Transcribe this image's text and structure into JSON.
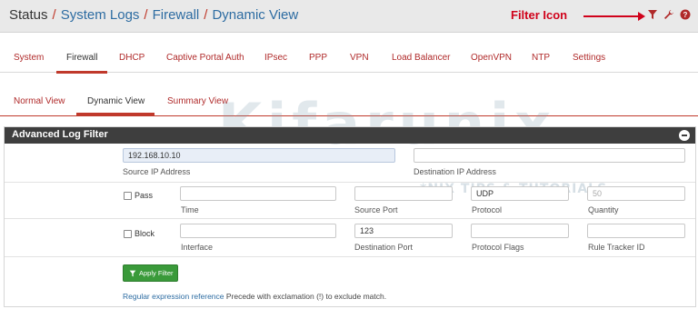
{
  "breadcrumb": {
    "root": "Status",
    "items": [
      "System Logs",
      "Firewall",
      "Dynamic View"
    ],
    "separator": "/"
  },
  "annotation": {
    "text": "Filter Icon",
    "color": "#d0021b"
  },
  "header_icons": [
    "filter-icon",
    "wrench-icon",
    "help-icon"
  ],
  "tabs": [
    {
      "label": "System",
      "active": false
    },
    {
      "label": "Firewall",
      "active": true
    },
    {
      "label": "DHCP",
      "active": false
    },
    {
      "label": "Captive Portal Auth",
      "active": false
    },
    {
      "label": "IPsec",
      "active": false
    },
    {
      "label": "PPP",
      "active": false
    },
    {
      "label": "VPN",
      "active": false
    },
    {
      "label": "Load Balancer",
      "active": false
    },
    {
      "label": "OpenVPN",
      "active": false
    },
    {
      "label": "NTP",
      "active": false
    },
    {
      "label": "Settings",
      "active": false
    }
  ],
  "subtabs": [
    {
      "label": "Normal View",
      "active": false
    },
    {
      "label": "Dynamic View",
      "active": true
    },
    {
      "label": "Summary View",
      "active": false
    }
  ],
  "panel": {
    "title": "Advanced Log Filter",
    "fields": {
      "source_ip": {
        "label": "Source IP Address",
        "value": "192.168.10.10"
      },
      "destination_ip": {
        "label": "Destination IP Address",
        "value": ""
      },
      "time": {
        "label": "Time",
        "value": ""
      },
      "source_port": {
        "label": "Source Port",
        "value": ""
      },
      "protocol": {
        "label": "Protocol",
        "value": "UDP"
      },
      "quantity": {
        "label": "Quantity",
        "placeholder": "50"
      },
      "interface": {
        "label": "Interface",
        "value": ""
      },
      "destination_port": {
        "label": "Destination Port",
        "value": "123"
      },
      "protocol_flags": {
        "label": "Protocol Flags",
        "value": ""
      },
      "rule_tracker_id": {
        "label": "Rule Tracker ID",
        "value": ""
      }
    },
    "checkboxes": {
      "pass": {
        "label": "Pass",
        "checked": false
      },
      "block": {
        "label": "Block",
        "checked": false
      }
    },
    "apply_button": "Apply Filter",
    "help": {
      "link": "Regular expression reference",
      "text": " Precede with exclamation (!) to exclude match."
    }
  },
  "watermark": {
    "main": "Kifarunix",
    "tagline": "*NIX TIPS & TUTORIALS"
  },
  "colors": {
    "accent_red": "#c0392b",
    "link_blue": "#2d6ca2",
    "panel_header": "#3e3e3e",
    "apply_green": "#3a9a3a"
  }
}
